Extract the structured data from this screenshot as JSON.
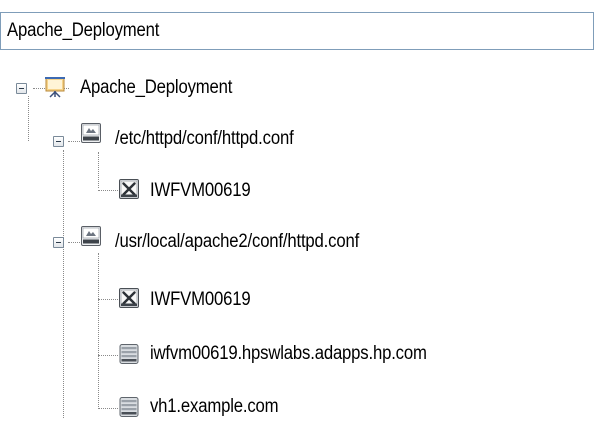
{
  "header": {
    "title": "Apache_Deployment"
  },
  "tree": {
    "root": {
      "label": "Apache_Deployment",
      "icon": "deployment-presentation-icon",
      "expanded": true
    },
    "configs": [
      {
        "label": "/etc/httpd/conf/httpd.conf",
        "icon": "config-file-icon",
        "expanded": true,
        "children": [
          {
            "label": "IWFVM00619",
            "icon": "unix-host-icon"
          }
        ]
      },
      {
        "label": "/usr/local/apache2/conf/httpd.conf",
        "icon": "config-file-icon",
        "expanded": true,
        "children": [
          {
            "label": "IWFVM00619",
            "icon": "unix-host-icon"
          },
          {
            "label": "iwfvm00619.hpswlabs.adapps.hp.com",
            "icon": "server-icon"
          },
          {
            "label": "vh1.example.com",
            "icon": "server-icon"
          }
        ]
      }
    ]
  }
}
